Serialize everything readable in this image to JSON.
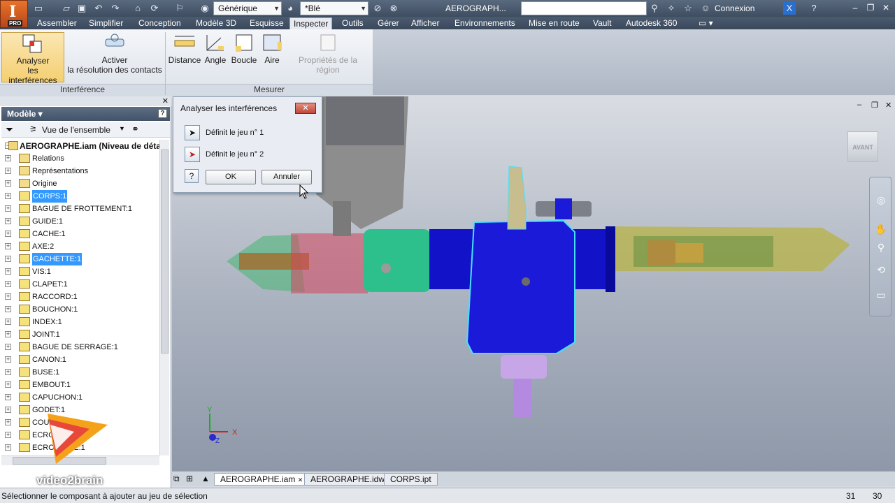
{
  "titlebar": {
    "app_badge": "PRO",
    "style_combo": "Générique",
    "material_combo": "*Blé",
    "app_title": "AEROGRAPH...",
    "login": "Connexion"
  },
  "menu": {
    "tabs": [
      "Assembler",
      "Simplifier",
      "Conception",
      "Modèle 3D",
      "Esquisse",
      "Inspecter",
      "Outils",
      "Gérer",
      "Afficher",
      "Environnements",
      "Mise en route",
      "Vault",
      "Autodesk 360"
    ],
    "active": "Inspecter"
  },
  "ribbon": {
    "interference": {
      "analyze_line1": "Analyser",
      "analyze_line2": "les interférences",
      "activate_line1": "Activer",
      "activate_line2": "la résolution des contacts",
      "panel_label": "Interférence"
    },
    "measure": {
      "distance": "Distance",
      "angle": "Angle",
      "loop": "Boucle",
      "area": "Aire",
      "region_props": "Propriétés de la région",
      "panel_label": "Mesurer"
    }
  },
  "browser": {
    "header": "Modèle ▾",
    "view_label": "Vue de l'ensemble",
    "root": "AEROGRAPHE.iam (Niveau de détail",
    "items": [
      {
        "label": "Relations",
        "type": "folder",
        "selected": false
      },
      {
        "label": "Représentations",
        "type": "folder",
        "selected": false
      },
      {
        "label": "Origine",
        "type": "folder",
        "selected": false
      },
      {
        "label": "CORPS:1",
        "type": "grounded",
        "selected": true
      },
      {
        "label": "BAGUE DE FROTTEMENT:1",
        "type": "part",
        "selected": false
      },
      {
        "label": "GUIDE:1",
        "type": "part",
        "selected": false
      },
      {
        "label": "CACHE:1",
        "type": "part",
        "selected": false
      },
      {
        "label": "AXE:2",
        "type": "part",
        "selected": false
      },
      {
        "label": "GACHETTE:1",
        "type": "part",
        "selected": true
      },
      {
        "label": "VIS:1",
        "type": "part",
        "selected": false
      },
      {
        "label": "CLAPET:1",
        "type": "part",
        "selected": false
      },
      {
        "label": "RACCORD:1",
        "type": "part",
        "selected": false
      },
      {
        "label": "BOUCHON:1",
        "type": "part",
        "selected": false
      },
      {
        "label": "INDEX:1",
        "type": "part",
        "selected": false
      },
      {
        "label": "JOINT:1",
        "type": "part",
        "selected": false
      },
      {
        "label": "BAGUE DE SERRAGE:1",
        "type": "part",
        "selected": false
      },
      {
        "label": "CANON:1",
        "type": "part",
        "selected": false
      },
      {
        "label": "BUSE:1",
        "type": "part",
        "selected": false
      },
      {
        "label": "EMBOUT:1",
        "type": "part",
        "selected": false
      },
      {
        "label": "CAPUCHON:1",
        "type": "part",
        "selected": false
      },
      {
        "label": "GODET:1",
        "type": "part",
        "selected": false
      },
      {
        "label": "COU",
        "type": "part",
        "selected": false
      },
      {
        "label": "ECRO      GE:1",
        "type": "part",
        "selected": false
      },
      {
        "label": "ECRO      GAGE:1",
        "type": "part",
        "selected": false
      }
    ]
  },
  "dialog": {
    "title": "Analyser les interférences",
    "set1": "Définit le jeu n° 1",
    "set2": "Définit le jeu n° 2",
    "ok": "OK",
    "cancel": "Annuler"
  },
  "viewcube_label": "AVANT",
  "axis": {
    "x": "X",
    "y": "Y",
    "z": "Z"
  },
  "doc_tabs": [
    "AEROGRAPHE.iam",
    "AEROGRAPHE.idw",
    "CORPS.ipt"
  ],
  "watermark": "video2brain",
  "status": {
    "text": "Sélectionner le composant à ajouter au jeu de sélection",
    "n1": "31",
    "n2": "30"
  }
}
